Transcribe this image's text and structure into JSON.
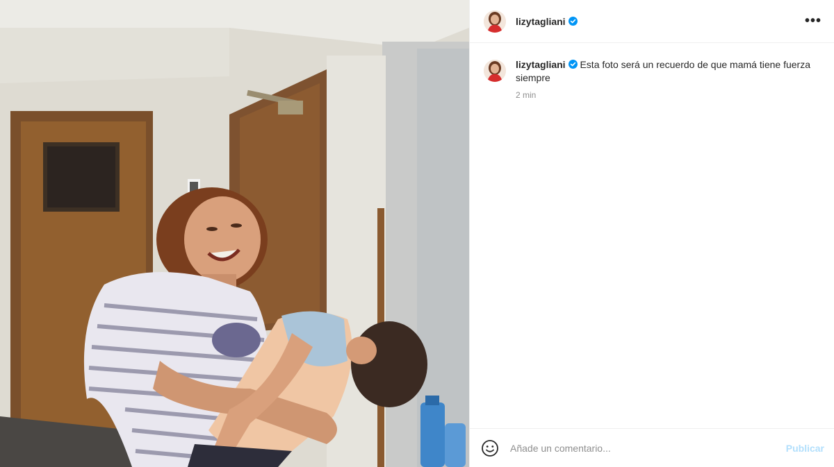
{
  "post": {
    "username": "lizytagliani",
    "verified_color": "#0095f6",
    "more_label": "•••",
    "caption": "Esta foto será un recuerdo de que mamá tiene fuerza siempre",
    "time_ago": "2 min"
  },
  "footer": {
    "comment_placeholder": "Añade un comentario...",
    "publish_label": "Publicar"
  },
  "photo": {
    "description_icon": "photo"
  }
}
